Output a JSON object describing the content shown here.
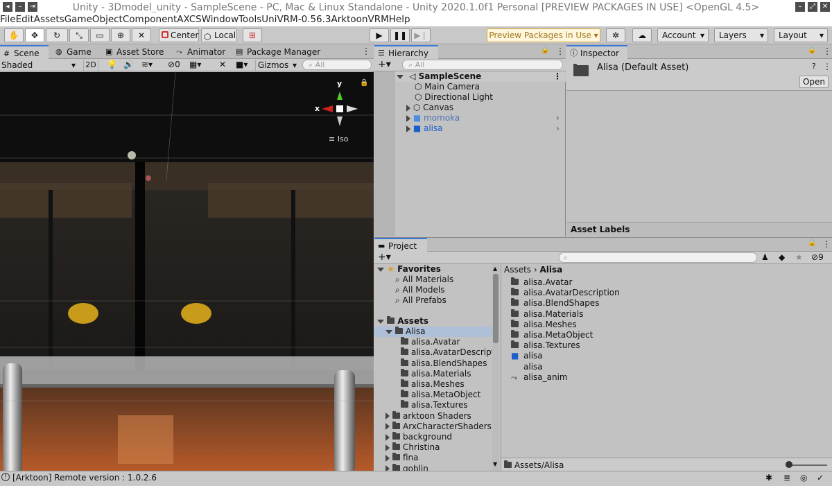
{
  "window": {
    "title": "Unity - 3Dmodel_unity - SampleScene - PC, Mac & Linux Standalone - Unity 2020.1.0f1 Personal [PREVIEW PACKAGES IN USE] <OpenGL 4.5>"
  },
  "menu": [
    "File",
    "Edit",
    "Assets",
    "GameObject",
    "Component",
    "AXCS",
    "Window",
    "Tools",
    "UniVRM-0.56.3",
    "Arktoon",
    "VRM",
    "Help"
  ],
  "toolbar": {
    "pivot_mode": "Center",
    "pivot_rotation": "Local",
    "preview_packages": "Preview Packages in Use",
    "account": "Account",
    "layers": "Layers",
    "layout": "Layout"
  },
  "scene_tabs": [
    "Scene",
    "Game",
    "Asset Store",
    "Animator",
    "Package Manager"
  ],
  "scene_toolbar": {
    "shading": "Shaded",
    "mode_2d": "2D",
    "hidden_count": "0",
    "gizmos": "Gizmos",
    "search_placeholder": "All"
  },
  "gizmo": {
    "x": "x",
    "y": "y",
    "projection": "Iso"
  },
  "hierarchy": {
    "tab": "Hierarchy",
    "search_placeholder": "All",
    "scene": "SampleScene",
    "items": [
      {
        "label": "Main Camera"
      },
      {
        "label": "Directional Light"
      },
      {
        "label": "Canvas"
      },
      {
        "label": "momoka"
      },
      {
        "label": "alisa"
      }
    ]
  },
  "inspector": {
    "tab": "Inspector",
    "asset_title": "Alisa (Default Asset)",
    "open_button": "Open",
    "asset_labels": "Asset Labels"
  },
  "project": {
    "tab": "Project",
    "hidden_count": "9",
    "favorites": {
      "label": "Favorites",
      "items": [
        "All Materials",
        "All Models",
        "All Prefabs"
      ]
    },
    "assets_label": "Assets",
    "tree": [
      {
        "label": "Alisa",
        "level": 1
      },
      {
        "label": "alisa.Avatar",
        "level": 2
      },
      {
        "label": "alisa.AvatarDescripti",
        "level": 2
      },
      {
        "label": "alisa.BlendShapes",
        "level": 2
      },
      {
        "label": "alisa.Materials",
        "level": 2
      },
      {
        "label": "alisa.Meshes",
        "level": 2
      },
      {
        "label": "alisa.MetaObject",
        "level": 2
      },
      {
        "label": "alisa.Textures",
        "level": 2
      },
      {
        "label": "arktoon Shaders",
        "level": 1
      },
      {
        "label": "ArxCharacterShaders",
        "level": 1
      },
      {
        "label": "background",
        "level": 1
      },
      {
        "label": "Christina",
        "level": 1
      },
      {
        "label": "fina",
        "level": 1
      },
      {
        "label": "goblin",
        "level": 1
      }
    ],
    "breadcrumb": {
      "root": "Assets",
      "current": "Alisa"
    },
    "contents": [
      {
        "label": "alisa.Avatar",
        "icon": "folder-icon"
      },
      {
        "label": "alisa.AvatarDescription",
        "icon": "folder-icon"
      },
      {
        "label": "alisa.BlendShapes",
        "icon": "folder-icon"
      },
      {
        "label": "alisa.Materials",
        "icon": "folder-icon"
      },
      {
        "label": "alisa.Meshes",
        "icon": "folder-icon"
      },
      {
        "label": "alisa.MetaObject",
        "icon": "folder-icon"
      },
      {
        "label": "alisa.Textures",
        "icon": "folder-icon"
      },
      {
        "label": "alisa",
        "icon": "prefab-icon"
      },
      {
        "label": "alisa",
        "icon": "none"
      },
      {
        "label": "alisa_anim",
        "icon": "animator-icon"
      }
    ],
    "footer_path": "Assets/Alisa"
  },
  "status": {
    "message": "[Arktoon] Remote version : 1.0.2.6"
  },
  "colors": {
    "accent": "#3a79d8",
    "selection": "#aebfd8",
    "prefab_blue": "#1a5fc9",
    "preview_border": "#d9a73c"
  }
}
